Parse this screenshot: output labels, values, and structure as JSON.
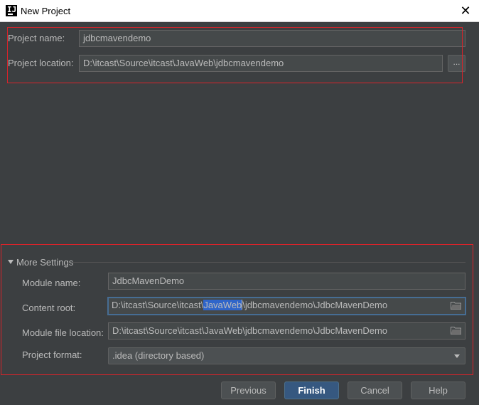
{
  "window": {
    "title": "New Project"
  },
  "project": {
    "name_label": "Project name:",
    "name_value": "jdbcmavendemo",
    "location_label": "Project location:",
    "location_value": "D:\\itcast\\Source\\itcast\\JavaWeb\\jdbcmavendemo",
    "browse_label": "..."
  },
  "more_settings": {
    "header": "More Settings",
    "module_name_label": "Module name:",
    "module_name_value": "JdbcMavenDemo",
    "content_root_label": "Content root:",
    "content_root_before": "D:\\itcast\\Source\\itcast\\",
    "content_root_selected": "JavaWeb",
    "content_root_after": "\\jdbcmavendemo\\JdbcMavenDemo",
    "module_file_label": "Module file location:",
    "module_file_value": "D:\\itcast\\Source\\itcast\\JavaWeb\\jdbcmavendemo\\JdbcMavenDemo",
    "project_format_label": "Project format:",
    "project_format_value": ".idea (directory based)"
  },
  "buttons": {
    "previous": "Previous",
    "finish": "Finish",
    "cancel": "Cancel",
    "help": "Help"
  },
  "colors": {
    "background": "#3c3f41",
    "field": "#45494a",
    "selection": "#2f65ca",
    "primary_button": "#365880",
    "highlight_box": "#d9232a"
  }
}
